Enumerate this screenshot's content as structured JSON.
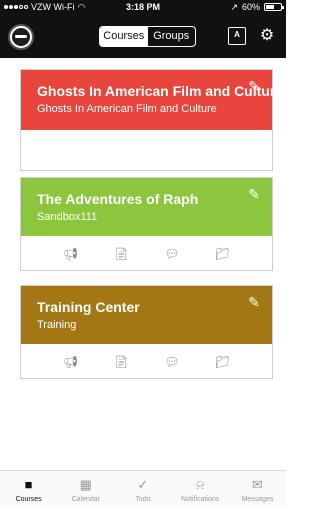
{
  "status_bar": {
    "carrier": "VZW Wi-Fi",
    "time": "3:18 PM",
    "battery": "60%",
    "battery_level": 0.6
  },
  "nav": {
    "segments": [
      {
        "label": "Courses",
        "active": true
      },
      {
        "label": "Groups",
        "active": false
      }
    ],
    "icons": [
      "avatar",
      "lcd-icon",
      "gear-icon"
    ]
  },
  "courses": [
    {
      "title": "Ghosts In American Film and Culture",
      "code": "Ghosts In American Film and Culture",
      "color": "#e8453c"
    },
    {
      "title": "The Adventures of Raph",
      "code": "Sandbox111",
      "color": "#8cc63f"
    },
    {
      "title": "Training Center",
      "code": "Training",
      "color": "#a27714"
    }
  ],
  "card_actions": [
    "announcements-icon",
    "assignments-icon",
    "discussions-icon",
    "files-icon"
  ],
  "tab_bar": [
    {
      "label": "Courses",
      "icon": "courses-icon",
      "active": true
    },
    {
      "label": "Calendar",
      "icon": "calendar-icon",
      "active": false
    },
    {
      "label": "Todo",
      "icon": "todo-check-icon",
      "active": false
    },
    {
      "label": "Notifications",
      "icon": "bell-icon",
      "active": false
    },
    {
      "label": "Messages",
      "icon": "envelope-icon",
      "active": false
    }
  ]
}
